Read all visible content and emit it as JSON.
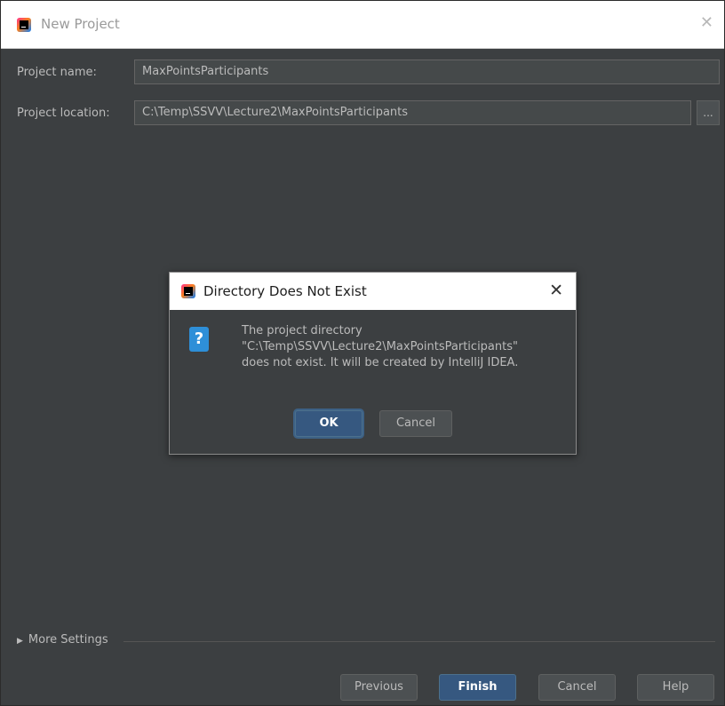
{
  "window": {
    "title": "New Project",
    "close_glyph": "✕"
  },
  "form": {
    "project_name_label": "Project name:",
    "project_name_value": "MaxPointsParticipants",
    "project_location_label": "Project location:",
    "project_location_value": "C:\\Temp\\SSVV\\Lecture2\\MaxPointsParticipants",
    "browse_label": "..."
  },
  "dialog": {
    "title": "Directory Does Not Exist",
    "close_glyph": "✕",
    "icon_glyph": "?",
    "message_lines": [
      "The project directory",
      "\"C:\\Temp\\SSVV\\Lecture2\\MaxPointsParticipants\"",
      "does not exist. It will be created by IntelliJ IDEA."
    ],
    "ok_label": "OK",
    "cancel_label": "Cancel"
  },
  "more_settings": {
    "label": "More Settings",
    "arrow": "▶"
  },
  "footer": {
    "previous_label": "Previous",
    "finish_label": "Finish",
    "cancel_label": "Cancel",
    "help_label": "Help"
  },
  "colors": {
    "background": "#3c3f41",
    "field_background": "#45494a",
    "default_button": "#365880",
    "question_icon": "#2e8fd8"
  }
}
